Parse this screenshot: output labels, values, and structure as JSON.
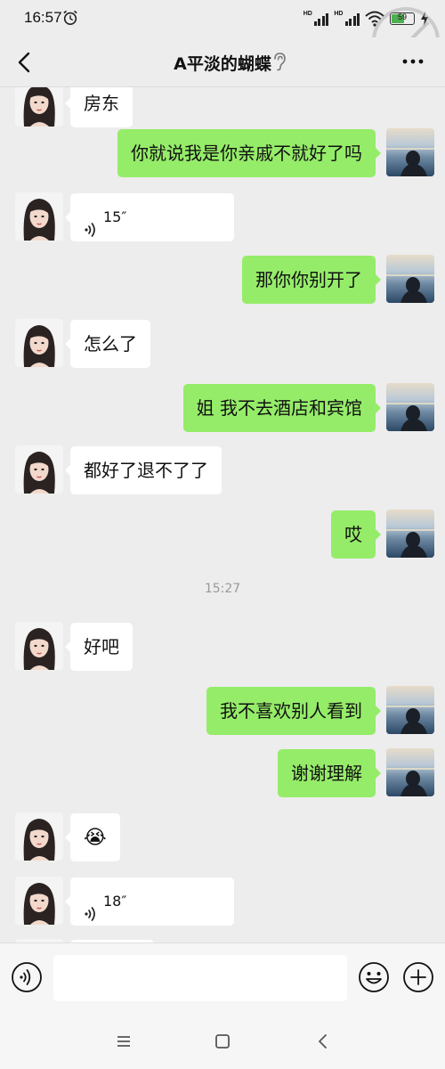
{
  "status_bar": {
    "time": "16:57",
    "net1": "HD",
    "net2": "HD",
    "battery": "59",
    "battery_level": 0.59
  },
  "header": {
    "title": "A平淡的蝴蝶",
    "back_icon": "chevron-left-icon",
    "more_icon": "more-icon",
    "ear_icon": "ear-icon"
  },
  "messages": [
    {
      "side": "in",
      "type": "text",
      "text": "房东"
    },
    {
      "side": "out",
      "type": "text",
      "text": "你就说我是你亲戚不就好了吗"
    },
    {
      "side": "in",
      "type": "voice",
      "text": "15″"
    },
    {
      "side": "out",
      "type": "text",
      "text": "那你你别开了"
    },
    {
      "side": "in",
      "type": "text",
      "text": "怎么了"
    },
    {
      "side": "out",
      "type": "text",
      "text": "姐  我不去酒店和宾馆"
    },
    {
      "side": "in",
      "type": "text",
      "text": "都好了退不了了"
    },
    {
      "side": "out",
      "type": "text",
      "text": "哎"
    },
    {
      "type": "time",
      "text": "15:27"
    },
    {
      "side": "in",
      "type": "text",
      "text": "好吧"
    },
    {
      "side": "out",
      "type": "text",
      "text": "我不喜欢别人看到"
    },
    {
      "side": "out",
      "type": "text",
      "text": "谢谢理解"
    },
    {
      "side": "in",
      "type": "emoji",
      "text": "😭"
    },
    {
      "side": "in",
      "type": "voice",
      "text": "18″"
    },
    {
      "side": "in",
      "type": "text",
      "text": ""
    }
  ],
  "input_bar": {
    "placeholder": "",
    "voice_icon": "voice-toggle-icon",
    "emoji_icon": "smiley-icon",
    "plus_icon": "plus-icon"
  },
  "nav_bar": {
    "icons": [
      "menu-icon",
      "home-icon",
      "back-icon"
    ]
  },
  "colors": {
    "outgoing_bubble": "#95ec69",
    "incoming_bubble": "#ffffff",
    "background": "#ededed"
  }
}
